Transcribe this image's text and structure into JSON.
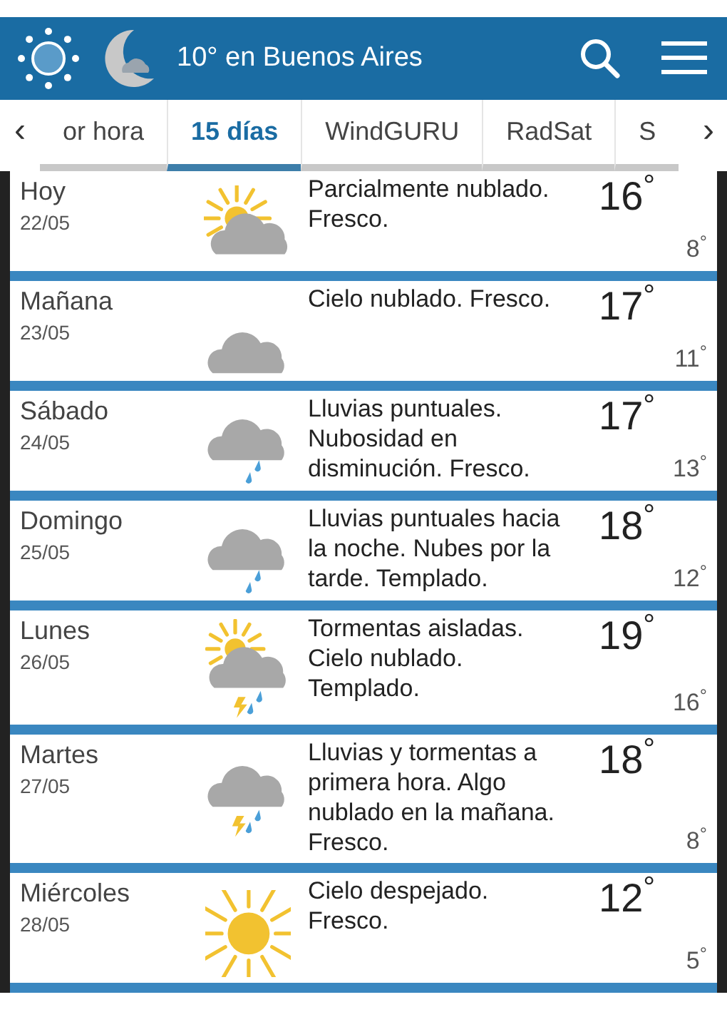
{
  "header": {
    "title": "10° en Buenos Aires"
  },
  "tabs": {
    "prev": "‹",
    "next": "›",
    "items": [
      {
        "label": "or hora",
        "selected": false
      },
      {
        "label": "15 días",
        "selected": true
      },
      {
        "label": "WindGURU",
        "selected": false
      },
      {
        "label": "RadSat",
        "selected": false
      },
      {
        "label": "S",
        "selected": false
      }
    ]
  },
  "days": [
    {
      "day": "Hoy",
      "date": "22/05",
      "kind": "partly_cloudy",
      "description": "Parcialmente nublado. Fresco.",
      "high": "16$^{°}$",
      "low": "8$^{°}$"
    },
    {
      "day": "Mañana",
      "date": "23/05",
      "kind": "cloudy",
      "description": "Cielo nublado. Fresco.",
      "high": "17$^{°}$",
      "low": "11$^{°}$"
    },
    {
      "day": "Sábado",
      "date": "24/05",
      "kind": "rain",
      "description": "Lluvias puntuales. Nubosidad en disminución. Fresco.",
      "high": "17$^{°}$",
      "low": "13$^{°}$"
    },
    {
      "day": "Domingo",
      "date": "25/05",
      "kind": "rain",
      "description": "Lluvias puntuales hacia la noche. Nubes por la tarde. Templado.",
      "high": "18$^{°}$",
      "low": "12$^{°}$"
    },
    {
      "day": "Lunes",
      "date": "26/05",
      "kind": "partly_storm",
      "description": "Tormentas aisladas. Cielo nublado. Templado.",
      "high": "19$^{°}$",
      "low": "16$^{°}$"
    },
    {
      "day": "Martes",
      "date": "27/05",
      "kind": "storm",
      "description": "Lluvias y tormentas a primera hora. Algo nublado en la mañana. Fresco.",
      "high": "18$^{°}$",
      "low": "8$^{°}$"
    },
    {
      "day": "Miércoles",
      "date": "28/05",
      "kind": "sunny",
      "description": "Cielo despejado. Fresco.",
      "high": "12$^{°}$",
      "low": "5$^{°}$"
    }
  ]
}
